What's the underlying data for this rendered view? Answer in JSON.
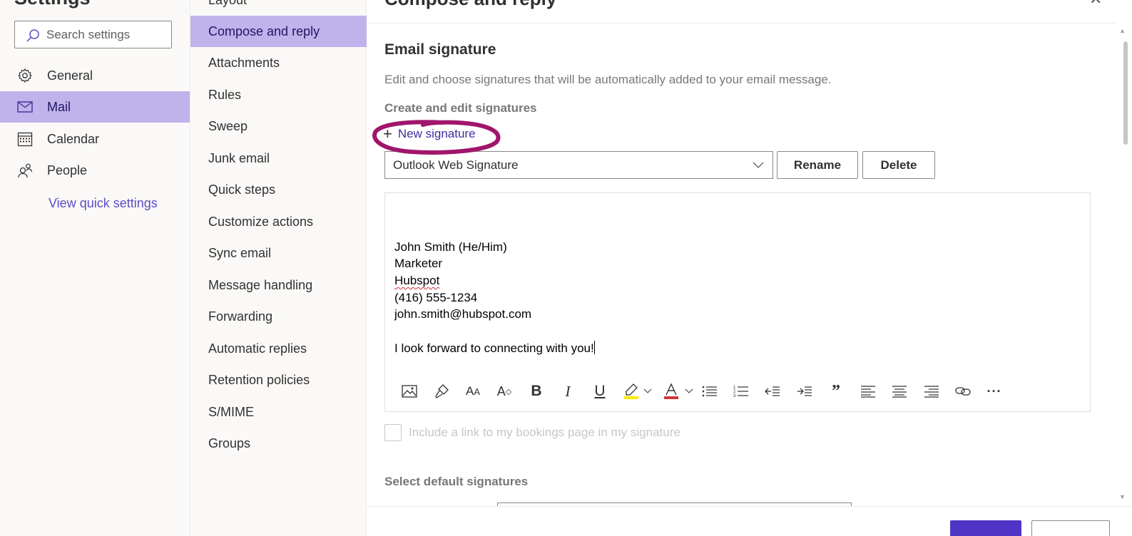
{
  "settings": {
    "title": "Settings",
    "search_placeholder": "Search settings",
    "categories": [
      {
        "label": "General",
        "icon": "gear-icon"
      },
      {
        "label": "Mail",
        "icon": "mail-icon",
        "selected": true
      },
      {
        "label": "Calendar",
        "icon": "calendar-icon"
      },
      {
        "label": "People",
        "icon": "people-icon"
      }
    ],
    "view_quick_settings": "View quick settings"
  },
  "mail_nav": {
    "items": [
      "Layout",
      "Compose and reply",
      "Attachments",
      "Rules",
      "Sweep",
      "Junk email",
      "Quick steps",
      "Customize actions",
      "Sync email",
      "Message handling",
      "Forwarding",
      "Automatic replies",
      "Retention policies",
      "S/MIME",
      "Groups"
    ],
    "selected": "Compose and reply"
  },
  "panel": {
    "title": "Compose and reply",
    "section_title": "Email signature",
    "section_description": "Edit and choose signatures that will be automatically added to your email message.",
    "create_label": "Create and edit signatures",
    "new_signature_label": "New signature",
    "selected_signature": "Outlook Web Signature",
    "rename_label": "Rename",
    "delete_label": "Delete",
    "signature_lines": [
      "",
      "John Smith (He/Him)",
      "Marketer",
      "Hubspot",
      "(416) 555-1234",
      "john.smith@hubspot.com",
      "",
      "I look forward to connecting with you!"
    ],
    "bookings_label": "Include a link to my bookings page in my signature",
    "default_signatures_label": "Select default signatures"
  },
  "toolbar": {
    "tools": [
      "insert-picture-icon",
      "format-painter-icon",
      "font-icon",
      "font-size-icon",
      "bold-icon",
      "italic-icon",
      "underline-icon",
      "highlight-icon",
      "font-color-icon",
      "bullets-icon",
      "numbering-icon",
      "decrease-indent-icon",
      "increase-indent-icon",
      "quote-icon",
      "align-left-icon",
      "align-center-icon",
      "align-right-icon",
      "link-icon",
      "more-options-icon"
    ]
  },
  "colors": {
    "accent": "#4f35c6",
    "selected_bg": "#c0b2ea",
    "link": "#5b4dc4",
    "annotation": "#a0166b",
    "highlight_yellow": "#ffe800",
    "font_red": "#d13438"
  }
}
